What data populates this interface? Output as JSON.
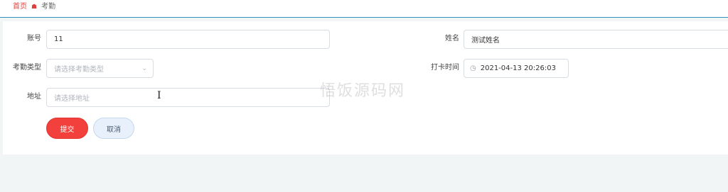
{
  "breadcrumb": {
    "home": "首页",
    "current": "考勤"
  },
  "form": {
    "account": {
      "label": "账号",
      "value": "11"
    },
    "name": {
      "label": "姓名",
      "value": "测试姓名"
    },
    "attendance_type": {
      "label": "考勤类型",
      "placeholder": "请选择考勤类型"
    },
    "clock_in_time": {
      "label": "打卡时间",
      "value": "2021-04-13 20:26:03"
    },
    "address": {
      "label": "地址",
      "placeholder": "请选择地址"
    }
  },
  "buttons": {
    "submit": "提交",
    "cancel": "取消"
  },
  "watermark": "悟饭源码网",
  "colors": {
    "accent": "#f2403c",
    "topbar_line": "#2e8fbd",
    "cancel_bg": "#e8f1fb"
  }
}
